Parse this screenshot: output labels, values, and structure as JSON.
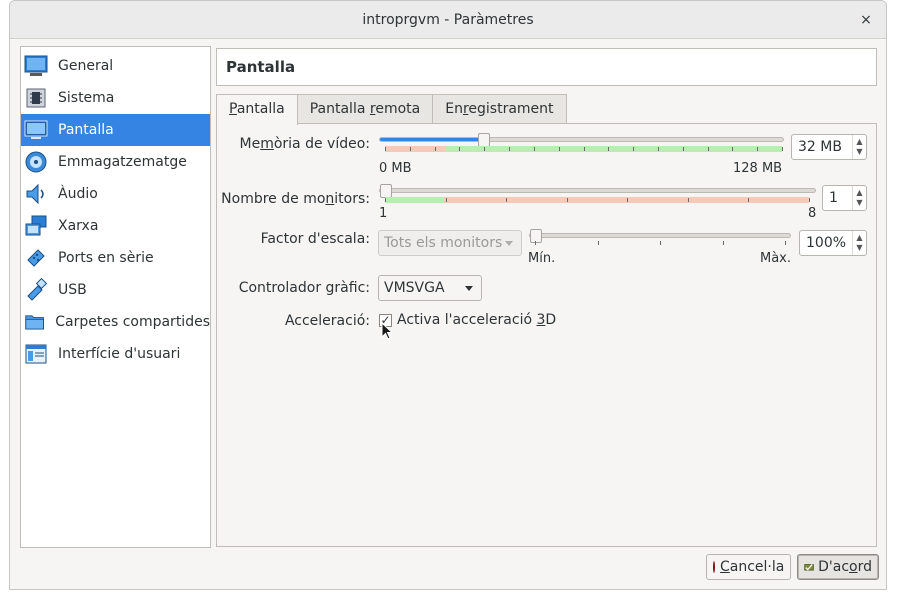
{
  "window": {
    "title": "introprgvm - Paràmetres",
    "close": "×"
  },
  "sidebar": {
    "items": [
      {
        "label": "General",
        "icon": "monitor-icon"
      },
      {
        "label": "Sistema",
        "icon": "chip-icon"
      },
      {
        "label": "Pantalla",
        "icon": "display-icon",
        "active": true
      },
      {
        "label": "Emmagatzematge",
        "icon": "disk-icon"
      },
      {
        "label": "Àudio",
        "icon": "speaker-icon"
      },
      {
        "label": "Xarxa",
        "icon": "network-icon"
      },
      {
        "label": "Ports en sèrie",
        "icon": "serial-port-icon"
      },
      {
        "label": "USB",
        "icon": "usb-icon"
      },
      {
        "label": "Carpetes compartides",
        "icon": "folder-icon"
      },
      {
        "label": "Interfície d'usuari",
        "icon": "window-ui-icon"
      }
    ]
  },
  "page": {
    "title": "Pantalla"
  },
  "tabs": [
    {
      "pre": "",
      "u": "P",
      "post": "antalla",
      "active": true
    },
    {
      "pre": "Pantalla ",
      "u": "r",
      "post": "emota"
    },
    {
      "pre": "En",
      "u": "r",
      "post": "egistrament"
    }
  ],
  "video_memory": {
    "label_pre": "Me",
    "label_u": "m",
    "label_post": "òria de vídeo:",
    "min_label": "0 MB",
    "max_label": "128 MB",
    "value": "32 MB",
    "fraction": 0.25
  },
  "monitors": {
    "label_pre": "Nombre de mo",
    "label_u": "n",
    "label_post": "itors:",
    "min_label": "1",
    "max_label": "8",
    "value": "1",
    "fraction": 0
  },
  "scale": {
    "label": "Factor d'escala:",
    "combo_value": "Tots els monitors",
    "min_label": "Mín.",
    "max_label": "Màx.",
    "value": "100%",
    "fraction": 0
  },
  "controller": {
    "label": "Controlador gràfic:",
    "value": "VMSVGA"
  },
  "acceleration": {
    "label": "Acceleració:",
    "checkbox_pre": "Activa l'acceleració ",
    "checkbox_u": "3",
    "checkbox_post": "D",
    "checked": true
  },
  "buttons": {
    "cancel_u": "C",
    "cancel_post": "ancel·la",
    "ok_pre": "D'ac",
    "ok_u": "o",
    "ok_post": "rd"
  },
  "colors": {
    "accent": "#3584e4",
    "green_zone": "#b5f0b0",
    "red_zone": "#f7c9b9"
  }
}
